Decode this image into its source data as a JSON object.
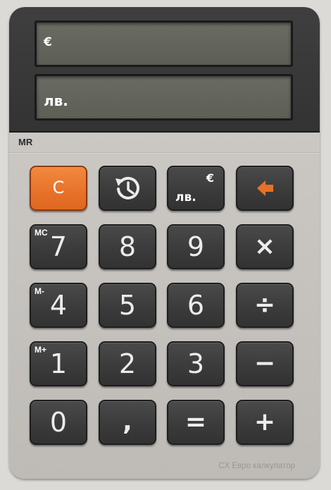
{
  "display": {
    "euro_label": "€",
    "euro_value": "",
    "leva_label": "лв.",
    "leva_value": ""
  },
  "memory_recall_label": "MR",
  "keys": {
    "clear": "C",
    "history_icon": "history-icon",
    "convert_euro": "€",
    "convert_leva": "лв.",
    "backspace_icon": "backspace-arrow-icon",
    "seven": "7",
    "seven_sub": "MC",
    "eight": "8",
    "nine": "9",
    "multiply": "×",
    "four": "4",
    "four_sub": "M-",
    "five": "5",
    "six": "6",
    "divide": "÷",
    "one": "1",
    "one_sub": "M+",
    "two": "2",
    "three": "3",
    "minus": "−",
    "zero": "0",
    "comma": ",",
    "equals": "=",
    "plus": "+"
  },
  "brand_text": "CX Евро калкулатор",
  "colors": {
    "accent_orange": "#e8712a",
    "key_dark": "#3a3a3a",
    "lcd": "#5d5e56",
    "body": "#c6c3bf"
  }
}
